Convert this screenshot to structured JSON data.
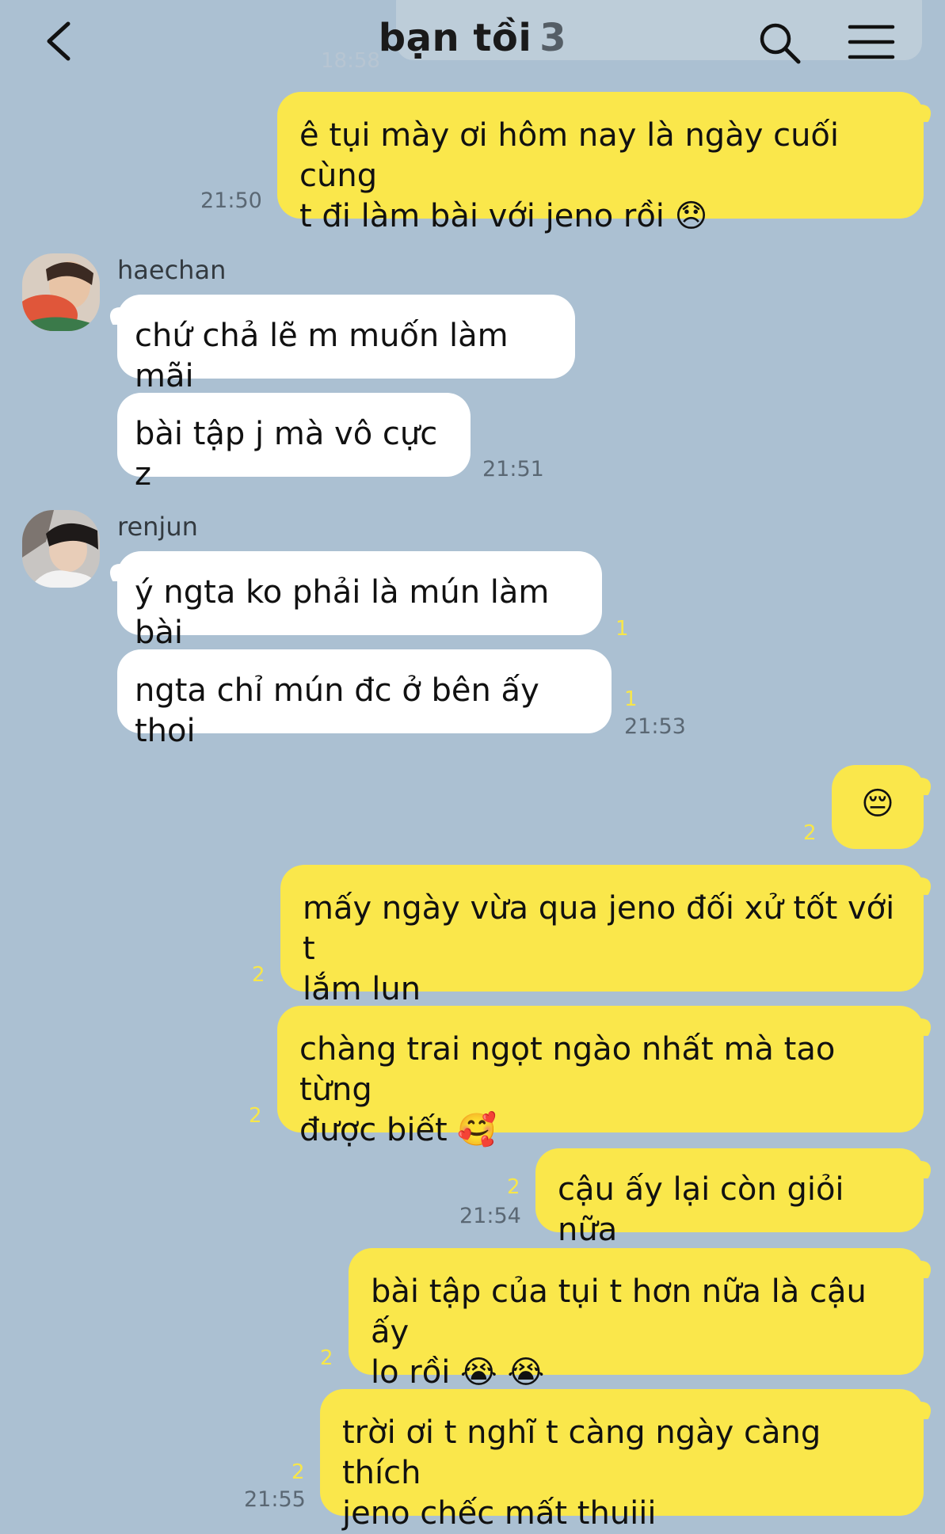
{
  "header": {
    "title": "bạn tồi",
    "member_count": "3",
    "ghost_time": "18:58"
  },
  "colors": {
    "background": "#abc0d2",
    "my_bubble": "#fae74b",
    "other_bubble": "#ffffff",
    "unread": "#f7e64a"
  },
  "messages": [
    {
      "sender": "me",
      "text": "ê tụi mày ơi hôm nay là ngày cuối cùng\nt đi làm bài với jeno rồi 😞",
      "time": "21:50"
    },
    {
      "sender": "haechan",
      "sender_name": "haechan",
      "text": "chứ chả lẽ m muốn làm mãi"
    },
    {
      "sender": "haechan",
      "text": "bài tập j mà vô cực z",
      "time": "21:51"
    },
    {
      "sender": "renjun",
      "sender_name": "renjun",
      "text": "ý ngta ko phải là mún làm bài",
      "unread": "1"
    },
    {
      "sender": "renjun",
      "text": "ngta chỉ mún đc ở bên ấy thoi",
      "unread": "1",
      "time": "21:53"
    },
    {
      "sender": "me",
      "text": "😔",
      "unread": "2"
    },
    {
      "sender": "me",
      "text": "mấy ngày vừa qua jeno đối xử tốt với t\nlắm lun",
      "unread": "2"
    },
    {
      "sender": "me",
      "text": "chàng trai ngọt ngào nhất mà tao từng\nđược biết 🥰",
      "unread": "2"
    },
    {
      "sender": "me",
      "text": "cậu ấy lại còn giỏi nữa",
      "unread": "2",
      "time": "21:54"
    },
    {
      "sender": "me",
      "text": "bài tập của tụi t hơn nữa là cậu ấy\nlo rồi 😭 😭",
      "unread": "2"
    },
    {
      "sender": "me",
      "text": "trời ơi t nghĩ t càng ngày càng thích\njeno chếc mất thuiii",
      "unread": "2",
      "time": "21:55"
    }
  ]
}
